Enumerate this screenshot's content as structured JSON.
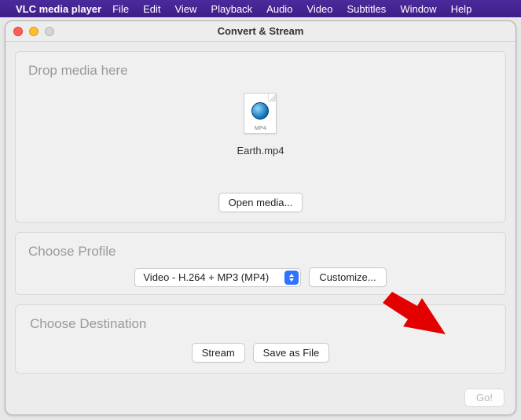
{
  "menubar": {
    "app_name": "VLC media player",
    "items": [
      "File",
      "Edit",
      "View",
      "Playback",
      "Audio",
      "Video",
      "Subtitles",
      "Window",
      "Help"
    ]
  },
  "window": {
    "title": "Convert & Stream"
  },
  "drop": {
    "label": "Drop media here",
    "file_name": "Earth.mp4",
    "file_ext": "MP4",
    "open_media_label": "Open media..."
  },
  "profile": {
    "label": "Choose Profile",
    "selected": "Video - H.264 + MP3 (MP4)",
    "customize_label": "Customize..."
  },
  "destination": {
    "label": "Choose Destination",
    "stream_label": "Stream",
    "save_label": "Save as File"
  },
  "footer": {
    "go_label": "Go!"
  }
}
